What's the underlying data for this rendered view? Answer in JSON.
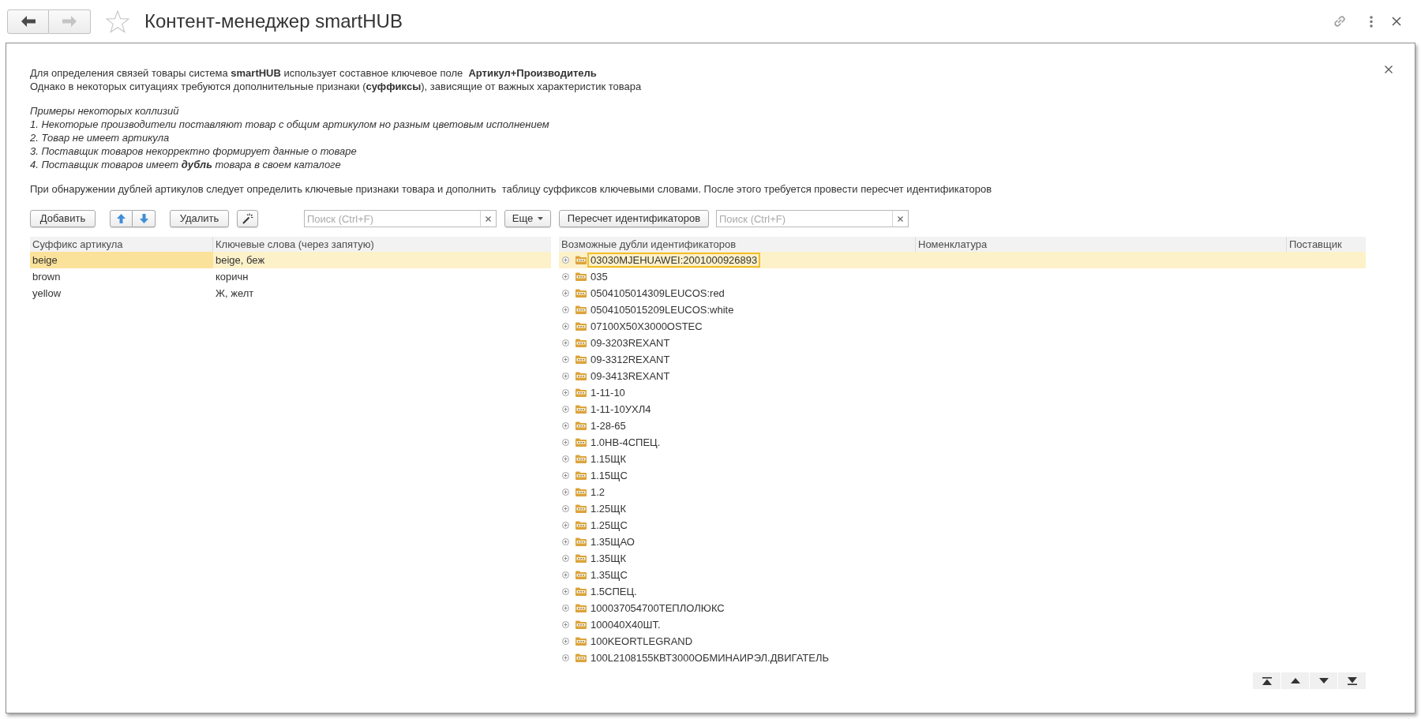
{
  "header": {
    "back": {
      "disabled": false
    },
    "forward": {
      "disabled": true
    },
    "favorite": false,
    "title": "Контент-менеджер smartHUB"
  },
  "info": {
    "intro": [
      "Для определения связей товары система **smartHUB** использует составное ключевое поле  **Артикул+Производитель**",
      "Однако в некоторых ситуациях требуются дополнительные признаки (**суффиксы**), зависящие от важных характеристик товара"
    ],
    "examples_title": "Примеры некоторых коллизий",
    "examples": [
      "1. Некоторые производители поставляют товар с общим артикулом но разным цветовым исполнением",
      "2. Товар не имеет артикула",
      "3. Поставщик товаров некорректно формирует данные о товаре",
      "4. Поставщик товаров имеет **дубль** товара в своем каталоге"
    ],
    "note": "При обнаружении дублей артикулов следует определить ключевые признаки товара и дополнить  таблицу суффиксов ключевыми словами. После этого требуется провести пересчет идентификаторов"
  },
  "suffix_panel": {
    "toolbar": {
      "add_button": "Добавить",
      "delete_button": "Удалить",
      "search": {
        "placeholder": "Поиск (Ctrl+F)"
      },
      "more_button": "Еще"
    },
    "table": {
      "columns": [
        "Суффикс артикула",
        "Ключевые слова (через запятую)"
      ],
      "rows": [
        {
          "cells": [
            "beige",
            "beige, беж"
          ],
          "selected": true
        },
        {
          "cells": [
            "brown",
            "коричн"
          ],
          "selected": false
        },
        {
          "cells": [
            "yellow",
            "Ж, желт"
          ],
          "selected": false
        }
      ]
    }
  },
  "duplicates_panel": {
    "toolbar": {
      "recalc_button": "Пересчет идентификаторов",
      "search": {
        "placeholder": "Поиск (Ctrl+F)"
      }
    },
    "tree": {
      "columns": [
        "Возможные дубли идентификаторов",
        "Номенклатура",
        "Поставщик"
      ],
      "rows": [
        {
          "id": "03030MJEHUAWEI:2001000926893",
          "selected": true,
          "expanded": false
        },
        {
          "id": "035",
          "selected": false,
          "expanded": false
        },
        {
          "id": "0504105014309LEUCOS:red",
          "selected": false,
          "expanded": false
        },
        {
          "id": "0504105015209LEUCOS:white",
          "selected": false,
          "expanded": false
        },
        {
          "id": "07100X50X3000OSTEC",
          "selected": false,
          "expanded": false
        },
        {
          "id": "09-3203REXANT",
          "selected": false,
          "expanded": false
        },
        {
          "id": "09-3312REXANT",
          "selected": false,
          "expanded": false
        },
        {
          "id": "09-3413REXANT",
          "selected": false,
          "expanded": false
        },
        {
          "id": "1-11-10",
          "selected": false,
          "expanded": false
        },
        {
          "id": "1-11-10УХЛ4",
          "selected": false,
          "expanded": false
        },
        {
          "id": "1-28-65",
          "selected": false,
          "expanded": false
        },
        {
          "id": "1.0НВ-4СПЕЦ.",
          "selected": false,
          "expanded": false
        },
        {
          "id": "1.15ЩК",
          "selected": false,
          "expanded": false
        },
        {
          "id": "1.15ЩС",
          "selected": false,
          "expanded": false
        },
        {
          "id": "1.2",
          "selected": false,
          "expanded": false
        },
        {
          "id": "1.25ЩК",
          "selected": false,
          "expanded": false
        },
        {
          "id": "1.25ЩС",
          "selected": false,
          "expanded": false
        },
        {
          "id": "1.35ЩАО",
          "selected": false,
          "expanded": false
        },
        {
          "id": "1.35ЩК",
          "selected": false,
          "expanded": false
        },
        {
          "id": "1.35ЩС",
          "selected": false,
          "expanded": false
        },
        {
          "id": "1.5СПЕЦ.",
          "selected": false,
          "expanded": false
        },
        {
          "id": "100037054700ТЕПЛОЛЮКС",
          "selected": false,
          "expanded": false
        },
        {
          "id": "100040X40ШТ.",
          "selected": false,
          "expanded": false
        },
        {
          "id": "100KEORTLEGRAND",
          "selected": false,
          "expanded": false
        },
        {
          "id": "100L2108155КВТ3000ОБМИНАИРЭЛ.ДВИГАТЕЛЬ",
          "selected": false,
          "expanded": false
        }
      ]
    }
  }
}
